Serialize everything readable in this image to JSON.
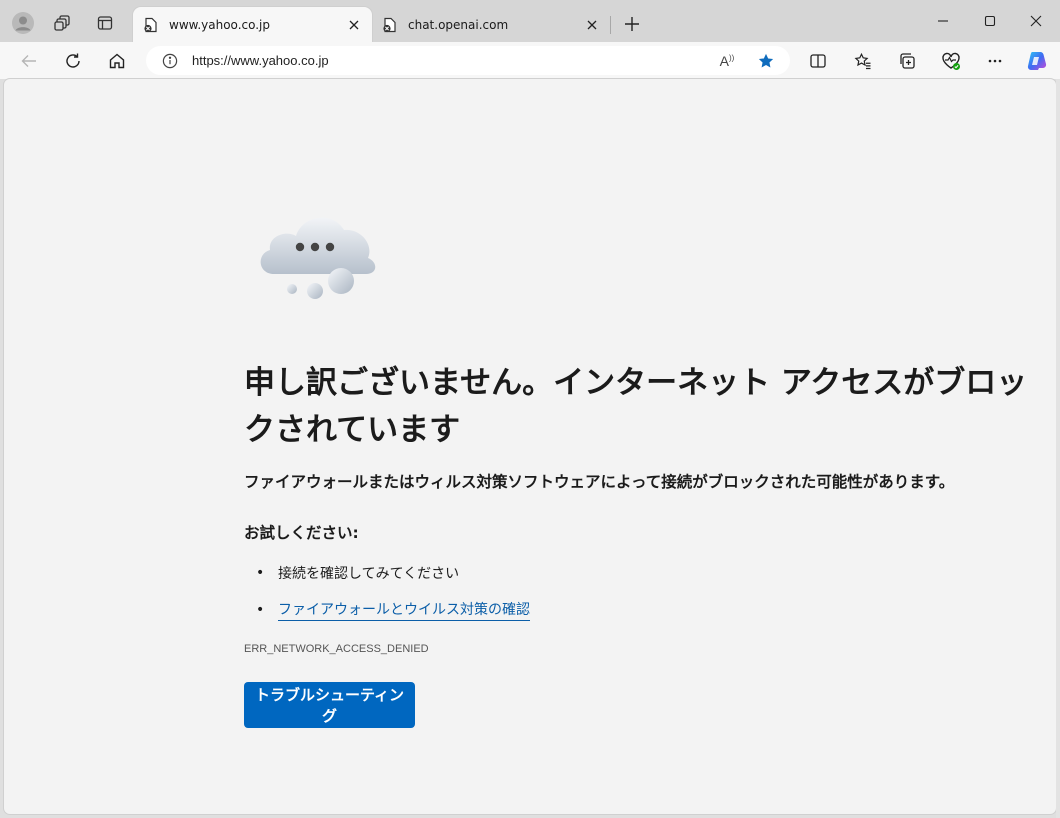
{
  "tabs": [
    {
      "title": "www.yahoo.co.jp",
      "active": true
    },
    {
      "title": "chat.openai.com",
      "active": false
    }
  ],
  "address_bar": {
    "url": "https://www.yahoo.co.jp"
  },
  "page": {
    "heading": "申し訳ございません。インターネット アクセスがブロックされています",
    "subtext": "ファイアウォールまたはウィルス対策ソフトウェアによって接続がブロックされた可能性があります。",
    "try_label": "お試しください:",
    "suggestions": [
      {
        "text": "接続を確認してみてください",
        "link": false
      },
      {
        "text": "ファイアウォールとウイルス対策の確認",
        "link": true
      }
    ],
    "error_code": "ERR_NETWORK_ACCESS_DENIED",
    "button_label": "トラブルシューティング"
  },
  "colors": {
    "accent": "#0067c0",
    "link": "#0b5ea8",
    "favorite_star": "#0f6cbd"
  },
  "icons": [
    "profile-icon",
    "workspaces-icon",
    "tab-actions-icon",
    "blocked-page-icon",
    "close-icon",
    "new-tab-icon",
    "minimize-icon",
    "maximize-icon",
    "window-close-icon",
    "back-icon",
    "refresh-icon",
    "home-icon",
    "info-icon",
    "read-aloud-icon",
    "favorite-star-icon",
    "split-screen-icon",
    "favorites-icon",
    "collections-icon",
    "browser-essentials-icon",
    "more-icon",
    "copilot-icon",
    "cloud-illustration"
  ]
}
